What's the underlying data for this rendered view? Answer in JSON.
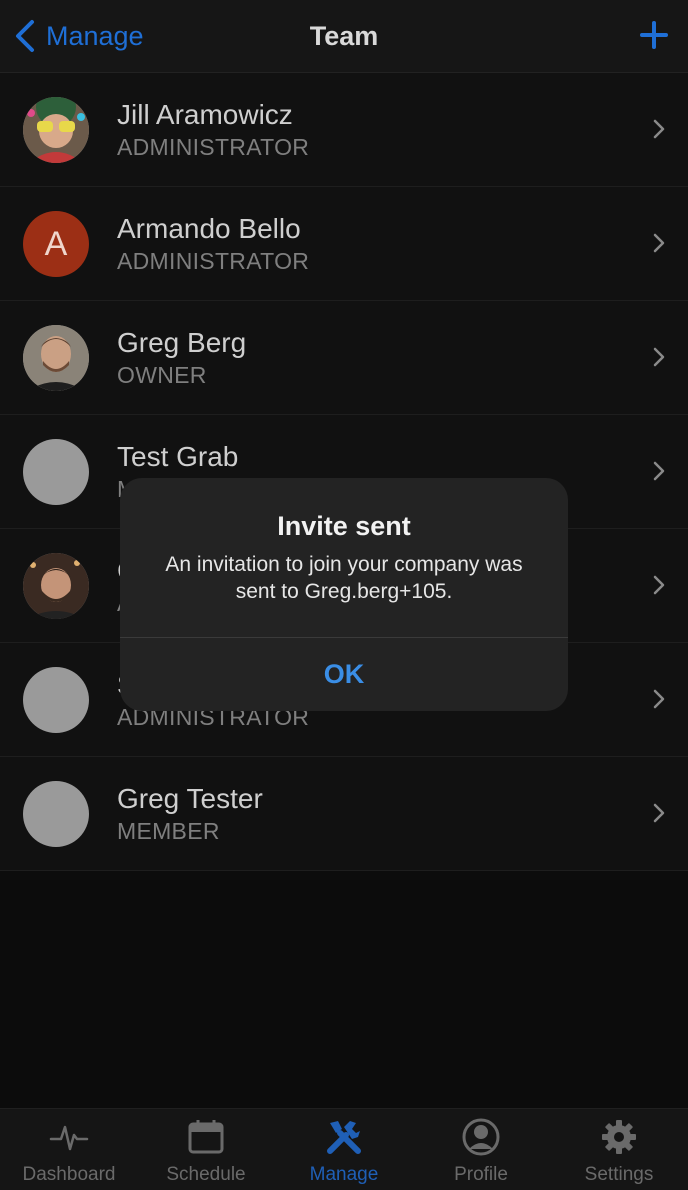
{
  "nav": {
    "back_label": "Manage",
    "title": "Team",
    "add_icon": "plus-icon"
  },
  "members": [
    {
      "name": "Jill Aramowicz",
      "role": "ADMINISTRATOR",
      "avatar": "photo"
    },
    {
      "name": "Armando Bello",
      "role": "ADMINISTRATOR",
      "avatar": "letter",
      "initial": "A",
      "color": "#9c2f15"
    },
    {
      "name": "Greg Berg",
      "role": "OWNER",
      "avatar": "photo"
    },
    {
      "name": "Test Grab",
      "role": "M",
      "avatar": "placeholder"
    },
    {
      "name": "G",
      "role": "A",
      "avatar": "photo"
    },
    {
      "name": "S",
      "role": "ADMINISTRATOR",
      "avatar": "placeholder"
    },
    {
      "name": "Greg Tester",
      "role": "MEMBER",
      "avatar": "placeholder"
    }
  ],
  "alert": {
    "title": "Invite sent",
    "message": "An invitation to join your company was sent to Greg.berg+105.",
    "ok_label": "OK"
  },
  "tabs": [
    {
      "label": "Dashboard",
      "icon": "pulse-icon"
    },
    {
      "label": "Schedule",
      "icon": "calendar-icon"
    },
    {
      "label": "Manage",
      "icon": "tools-icon",
      "active": true
    },
    {
      "label": "Profile",
      "icon": "user-circle-icon"
    },
    {
      "label": "Settings",
      "icon": "gear-icon"
    }
  ],
  "colors": {
    "accent": "#1f6fd6",
    "background": "#0c0c0c",
    "alert_button": "#3a8ee6"
  }
}
